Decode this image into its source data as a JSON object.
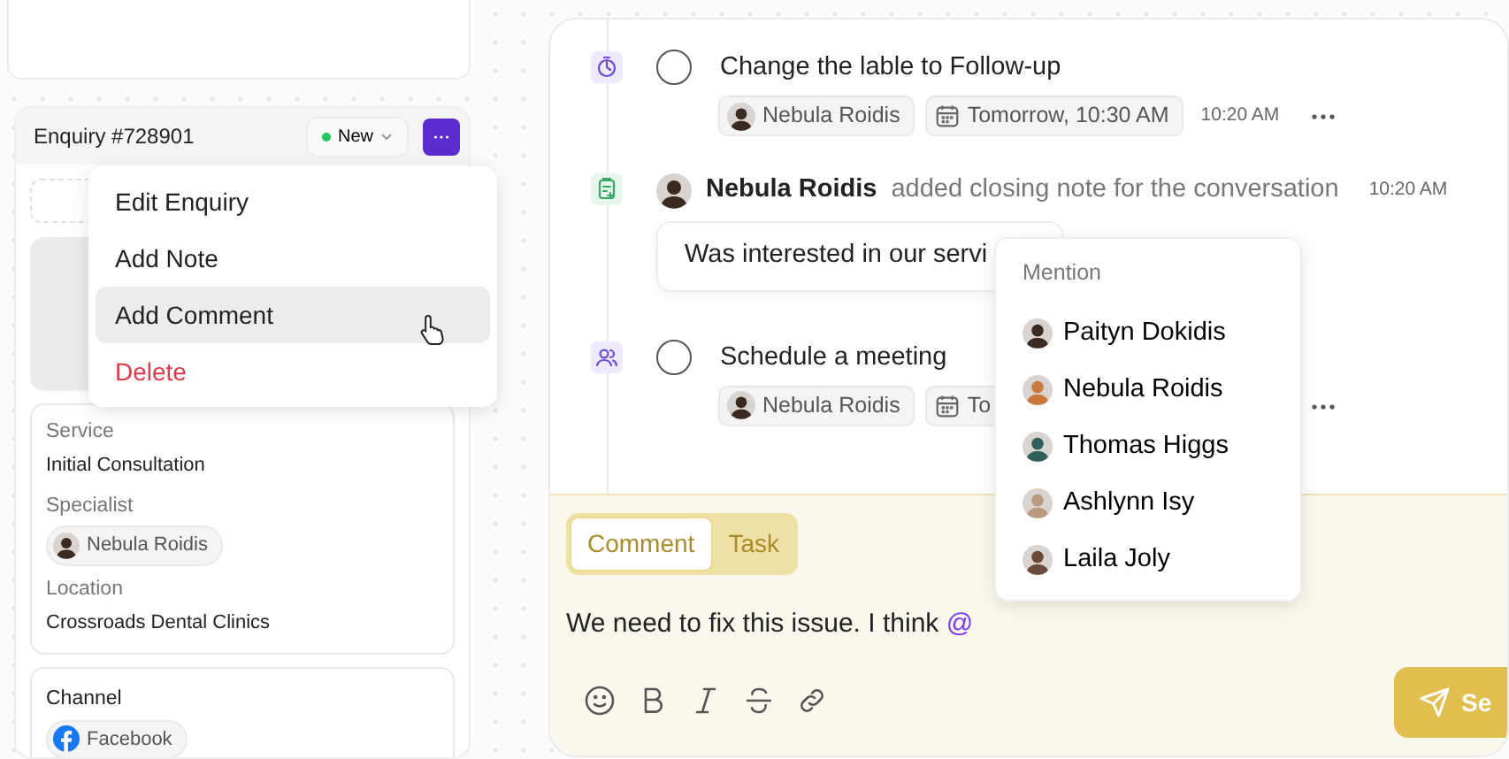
{
  "side_panel": {
    "title": "Enquiry #728901",
    "status": "New"
  },
  "menu": [
    {
      "label": "Edit Enquiry",
      "kind": "normal",
      "highlighted": false
    },
    {
      "label": "Add Note",
      "kind": "normal",
      "highlighted": false
    },
    {
      "label": "Add Comment",
      "kind": "normal",
      "highlighted": true
    },
    {
      "label": "Delete",
      "kind": "danger",
      "highlighted": false
    }
  ],
  "details": [
    {
      "label": "Service",
      "value": "Initial Consultation",
      "kind": "text"
    },
    {
      "label": "Specialist",
      "value": "Nebula Roidis",
      "kind": "person"
    },
    {
      "label": "Location",
      "value": "Crossroads Dental Clinics",
      "kind": "text"
    }
  ],
  "channel": {
    "label": "Channel",
    "value": "Facebook"
  },
  "timeline": [
    {
      "kind": "reminder",
      "done": false,
      "title": "Change the lable to Follow-up",
      "assignee": "Nebula Roidis",
      "due": "Tomorrow, 10:30 AM",
      "time": "10:20 AM"
    },
    {
      "kind": "note",
      "author": "Nebula Roidis",
      "action": "added closing note for the conversation",
      "time": "10:20 AM",
      "note": "Was interested in our servi"
    },
    {
      "kind": "meeting",
      "done": false,
      "title": "Schedule a meeting",
      "assignee": "Nebula Roidis",
      "due": "To"
    }
  ],
  "composer": {
    "tabs": [
      {
        "label": "Comment",
        "selected": true
      },
      {
        "label": "Task",
        "selected": false
      }
    ],
    "text": "We need to fix this issue. I think ",
    "trigger": "@",
    "send": "Se"
  },
  "mention": {
    "title": "Mention",
    "people": [
      "Paityn Dokidis",
      "Nebula Roidis",
      "Thomas Higgs",
      "Ashlynn Isy",
      "Laila Joly"
    ]
  }
}
